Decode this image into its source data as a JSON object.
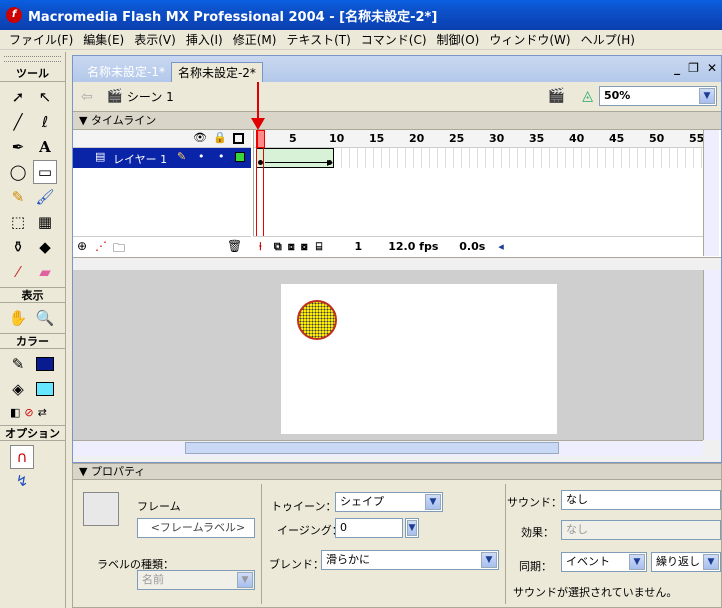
{
  "window": {
    "title": "Macromedia Flash MX Professional 2004 - [名称未設定-2*]",
    "app_icon": "f"
  },
  "menu": [
    "ファイル(F)",
    "編集(E)",
    "表示(V)",
    "挿入(I)",
    "修正(M)",
    "テキスト(T)",
    "コマンド(C)",
    "制御(O)",
    "ウィンドウ(W)",
    "ヘルプ(H)"
  ],
  "tools": {
    "title": "ツール",
    "view_title": "表示",
    "color_title": "カラー",
    "options_title": "オプション",
    "stroke_color": "#0a1a8f",
    "fill_color": "#66e6ff"
  },
  "document": {
    "tabs": [
      "名称未設定-1*",
      "名称未設定-2*"
    ],
    "active_tab": 1,
    "scene": "シーン 1",
    "zoom": "50%"
  },
  "timeline": {
    "title": "タイムライン",
    "layer_name": "レイヤー 1",
    "frame_ticks": [
      "1",
      "5",
      "10",
      "15",
      "20",
      "25",
      "30",
      "35",
      "40",
      "45",
      "50",
      "55"
    ],
    "current_frame": "1",
    "fps": "12.0 fps",
    "elapsed": "0.0s"
  },
  "properties": {
    "title": "プロパティ",
    "frame_label": "フレーム",
    "frame_label_placeholder": "<フレームラベル>",
    "label_type_label": "ラベルの種類：",
    "label_type_value": "名前",
    "tween_label": "トゥイーン：",
    "tween_value": "シェイプ",
    "easing_label": "イージング：",
    "easing_value": "0",
    "blend_label": "ブレンド：",
    "blend_value": "滑らかに",
    "sound_label": "サウンド：",
    "sound_value": "なし",
    "effect_label": "効果：",
    "effect_value": "なし",
    "sync_label": "同期：",
    "sync_value": "イベント",
    "repeat_value": "繰り返し",
    "sound_status": "サウンドが選択されていません。"
  },
  "colors": {
    "accent_red": "#e00000",
    "circle_fill": "#ffee00",
    "circle_stroke": "#c0301a"
  }
}
